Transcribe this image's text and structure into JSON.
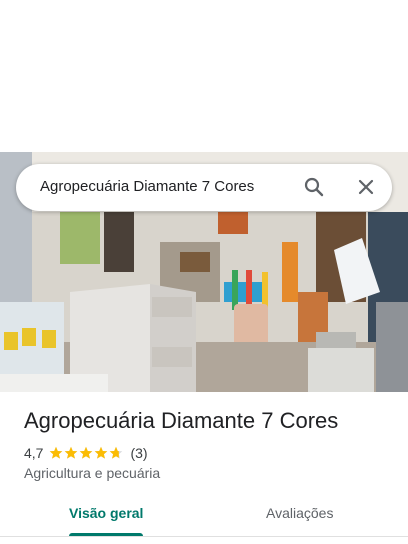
{
  "search": {
    "query": "Agropecuária Diamante 7 Cores"
  },
  "place": {
    "name": "Agropecuária Diamante 7 Cores",
    "rating": "4,7",
    "stars": 4.7,
    "review_count": "(3)",
    "category": "Agricultura e pecuária"
  },
  "tabs": [
    {
      "label": "Visão geral",
      "active": true
    },
    {
      "label": "Avaliações",
      "active": false
    }
  ],
  "colors": {
    "accent": "#00796b",
    "star": "#fbbc04"
  }
}
